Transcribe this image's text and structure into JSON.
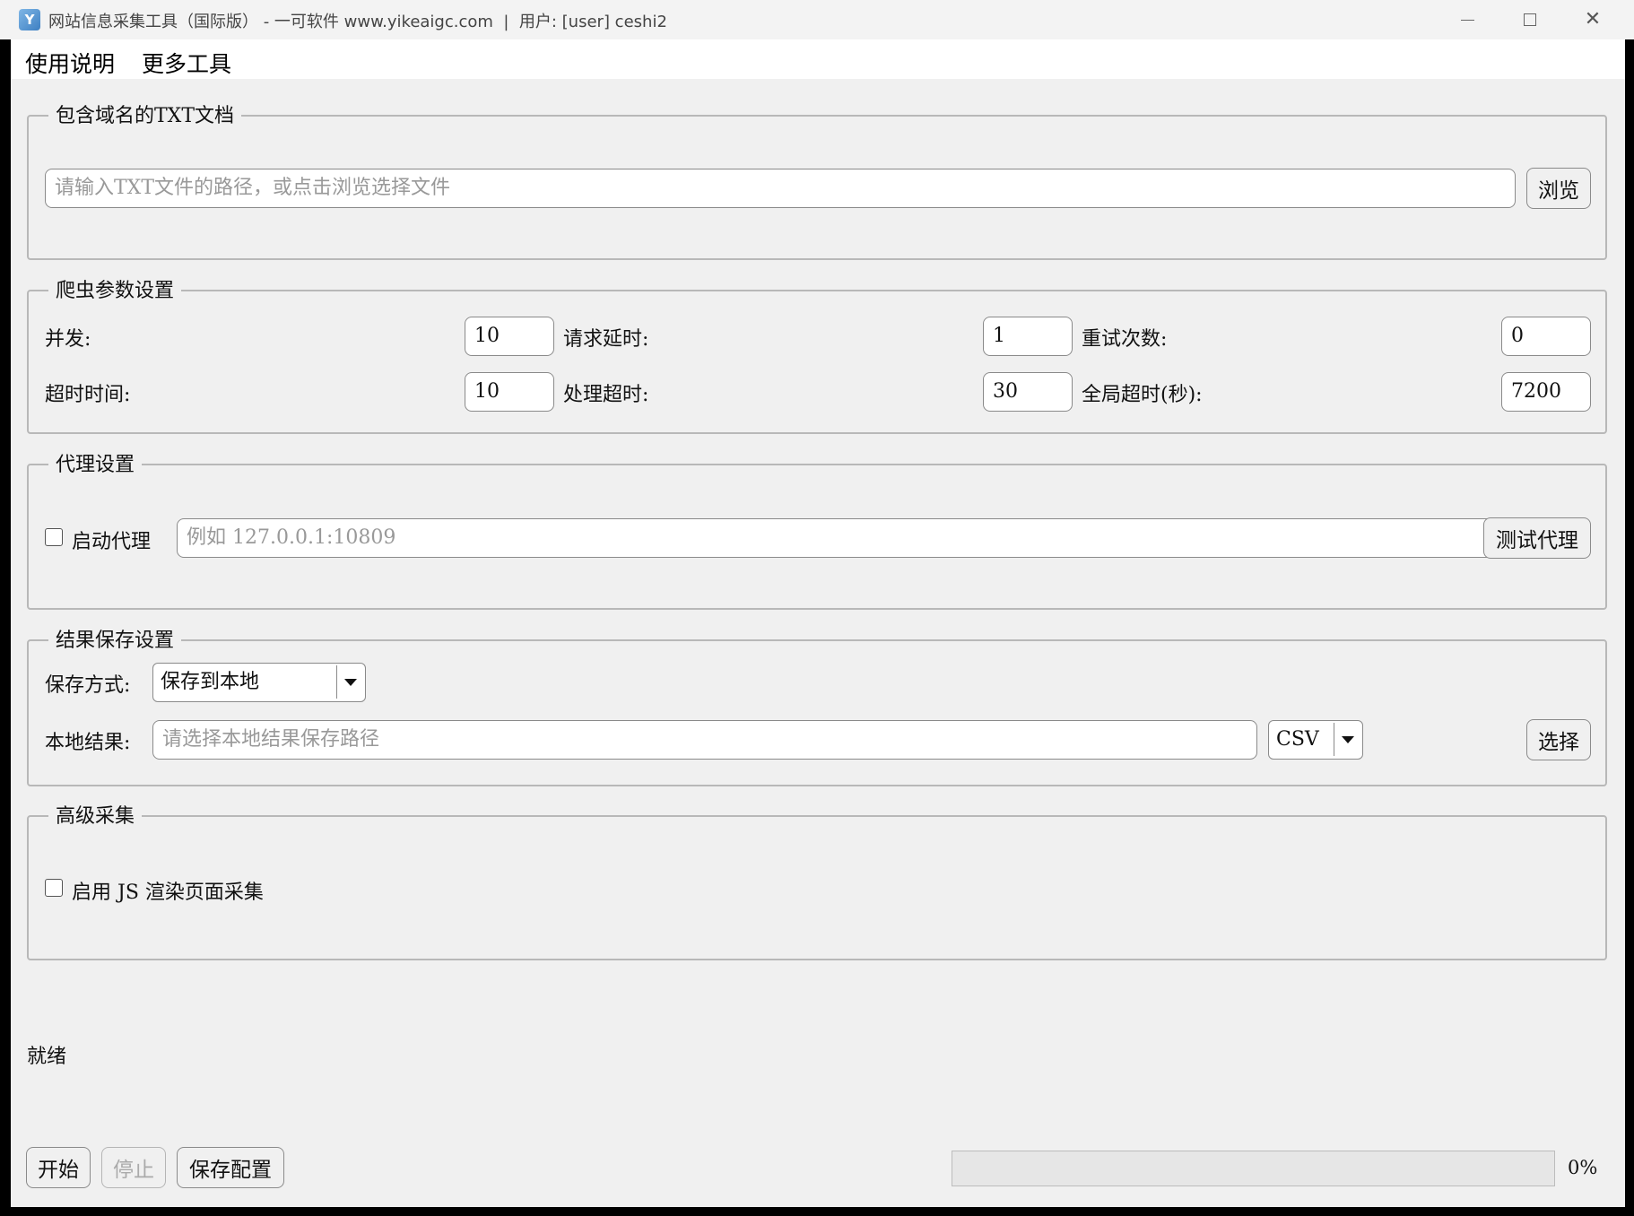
{
  "window": {
    "app_icon": "Y",
    "title": "网站信息采集工具（国际版） - 一可软件 www.yikeaigc.com  |  用户: [user] ceshi2",
    "minimize_icon": "minimize-icon",
    "maximize_icon": "maximize-icon",
    "close_icon": "close-icon",
    "close_glyph": "✕"
  },
  "menu": {
    "help": "使用说明",
    "tools": "更多工具"
  },
  "txt_group": {
    "title": "包含域名的TXT文档",
    "path_placeholder": "请输入TXT文件的路径，或点击浏览选择文件",
    "browse": "浏览"
  },
  "crawler_group": {
    "title": "爬虫参数设置",
    "concurrency_label": "并发:",
    "concurrency": "10",
    "delay_label": "请求延时:",
    "delay": "1",
    "retries_label": "重试次数:",
    "retries": "0",
    "timeout_label": "超时时间:",
    "timeout": "10",
    "process_timeout_label": "处理超时:",
    "process_timeout": "30",
    "global_timeout_label": "全局超时(秒):",
    "global_timeout": "7200"
  },
  "proxy_group": {
    "title": "代理设置",
    "enable_label": "启动代理",
    "enabled": false,
    "address_placeholder": "例如 127.0.0.1:10809",
    "test": "测试代理"
  },
  "save_group": {
    "title": "结果保存设置",
    "mode_label": "保存方式:",
    "mode_value": "保存到本地",
    "local_label": "本地结果:",
    "path_placeholder": "请选择本地结果保存路径",
    "format_value": "CSV",
    "choose": "选择"
  },
  "advanced_group": {
    "title": "高级采集",
    "js_label": "启用 JS 渲染页面采集",
    "enabled": false
  },
  "status": {
    "text": "就绪"
  },
  "actions": {
    "start": "开始",
    "stop": "停止",
    "save_config": "保存配置"
  },
  "progress": {
    "value": 0,
    "text": "0%",
    "fill_color": "#06b025"
  }
}
